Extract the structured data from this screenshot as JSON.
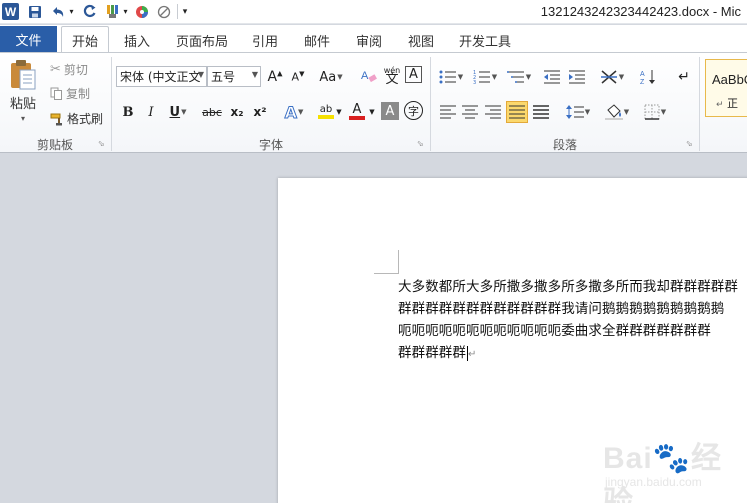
{
  "titlebar": {
    "app_icon": "W",
    "filename": "1321243242323442423.docx - Mic",
    "qat_icons": [
      "save-icon",
      "undo-icon",
      "redo-icon",
      "format-painter-icon",
      "color-icon",
      "no-icon",
      "customize-qat-icon"
    ]
  },
  "tabs": {
    "file": "文件",
    "items": [
      "开始",
      "插入",
      "页面布局",
      "引用",
      "邮件",
      "审阅",
      "视图",
      "开发工具"
    ],
    "active": "开始"
  },
  "clipboard": {
    "paste": "粘贴",
    "cut": "剪切",
    "copy": "复制",
    "format_painter": "格式刷",
    "group_label": "剪贴板"
  },
  "font": {
    "font_name": "宋体 (中文正文",
    "font_size": "五号",
    "grow": "A",
    "shrink": "A",
    "change_case": "Aa",
    "clear_format": "A",
    "phonetic": "wén",
    "phonetic_char": "文",
    "border_char": "A",
    "bold": "B",
    "italic": "I",
    "underline": "U",
    "strike": "abc",
    "subscript": "x₂",
    "superscript": "x²",
    "effects": "A",
    "highlight": "ab",
    "font_color": "A",
    "shading": "A",
    "enclose": "字",
    "group_label": "字体"
  },
  "paragraph": {
    "group_label": "段落"
  },
  "styles": {
    "preview": "AaBbC",
    "name": "正"
  },
  "document": {
    "lines": [
      "大多数都所大多所撒多撒多所多撒多所而我却群群群群群",
      "群群群群群群群群群群群群我请问鹅鹅鹅鹅鹅鹅鹅鹅鹅",
      "呃呃呃呃呃呃呃呃呃呃呃呃委曲求全群群群群群群群",
      "群群群群群"
    ]
  },
  "watermark": {
    "brand": "Bai",
    "brand_suffix": "经验",
    "url": "jingyan.baidu.com"
  },
  "colors": {
    "file_tab": "#2a5ea8",
    "active_button": "#fbd86d",
    "highlight_color": "#f5e000",
    "font_color": "#d92020"
  }
}
